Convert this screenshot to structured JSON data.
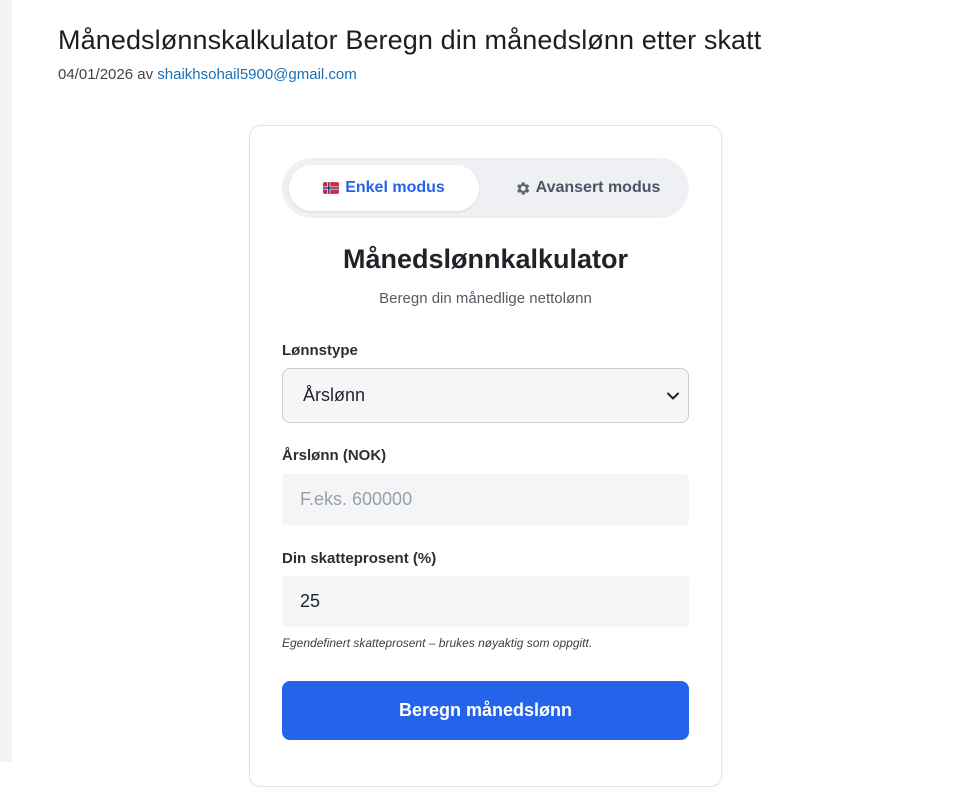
{
  "post": {
    "title": "Månedslønnskalkulator Beregn din månedslønn etter skatt",
    "date": "04/01/2026",
    "by": "av",
    "author": "shaikhsohail5900@gmail.com"
  },
  "calculator": {
    "modes": {
      "simple_label": "Enkel modus",
      "advanced_label": "Avansert modus",
      "active": "simple"
    },
    "title": "Månedslønnkalkulator",
    "subtitle": "Beregn din månedlige nettolønn",
    "salary_type": {
      "label": "Lønnstype",
      "selected": "Årslønn"
    },
    "salary": {
      "label": "Årslønn (NOK)",
      "placeholder": "F.eks. 600000",
      "value": ""
    },
    "tax": {
      "label": "Din skatteprosent (%)",
      "value": "25",
      "hint": "Egendefinert skatteprosent – brukes nøyaktig som oppgitt."
    },
    "submit_label": "Beregn månedslønn"
  },
  "colors": {
    "accent": "#2563eb",
    "link": "#1a6fb5"
  },
  "icons": {
    "simple_mode": "norway-flag-icon",
    "advanced_mode": "gear-icon",
    "select": "chevron-down-icon"
  }
}
